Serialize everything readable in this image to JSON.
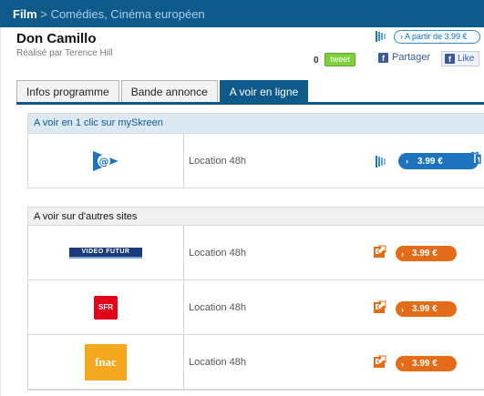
{
  "breadcrumb": {
    "film": "Film",
    "sep": " > ",
    "category": "Comédies, Cinéma européen"
  },
  "movie": {
    "title": "Don Camillo",
    "director": "Réalisé par Terence Hill"
  },
  "header": {
    "price_pill": "› A partir de 3.99 €",
    "tweet_count": "0",
    "tweet_label": "tweet",
    "share_label": "Partager",
    "like_label": "Like"
  },
  "tabs": [
    {
      "label": "Infos programme"
    },
    {
      "label": "Bande annonce"
    },
    {
      "label": "A voir en ligne",
      "active": true
    }
  ],
  "sections": {
    "myskreen": {
      "heading": "A voir en 1 clic sur mySkreen",
      "rows": [
        {
          "provider": "mySkreen",
          "offer": "Location 48h",
          "price": "3.99 €"
        }
      ]
    },
    "others": {
      "heading": "A voir sur d'autres sites",
      "rows": [
        {
          "provider": "Video Futur",
          "logo_text": "VIDEO FUTUR",
          "offer": "Location 48h",
          "price": "3.99 €"
        },
        {
          "provider": "SFR",
          "logo_text": "SFR",
          "offer": "Location 48h",
          "price": "3.99 €"
        },
        {
          "provider": "fnac.com",
          "logo_text": "fnac",
          "offer": "Location 48h",
          "price": "3.99 €"
        }
      ]
    }
  },
  "colors": {
    "brand_blue": "#0e5a8a",
    "price_blue": "#1e73be",
    "price_orange": "#e46b18",
    "tweet_green": "#7fcf3f",
    "facebook": "#3b5998"
  },
  "icons": [
    "myskreen-logo-icon",
    "tweet-icon",
    "facebook-icon",
    "external-link-icon",
    "gift-icon",
    "chevron-right-icon"
  ]
}
